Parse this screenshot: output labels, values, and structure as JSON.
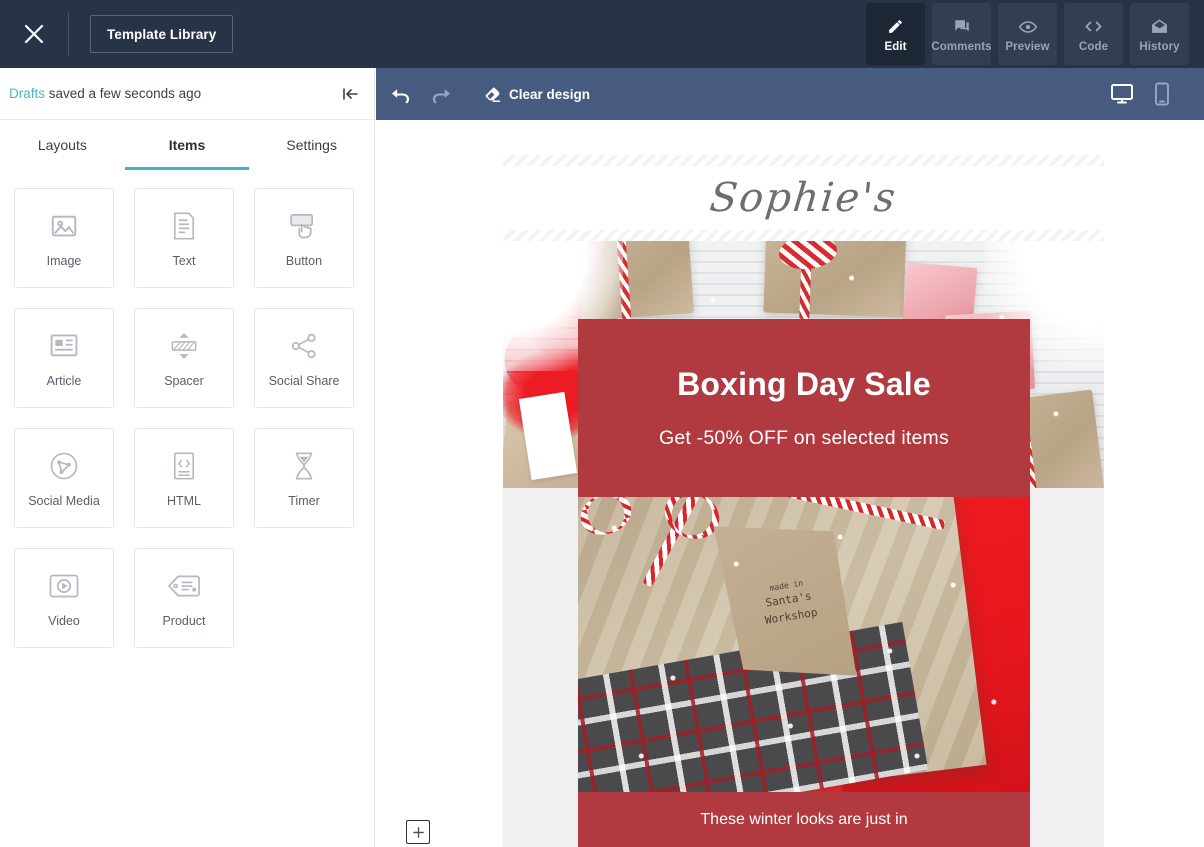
{
  "topbar": {
    "close_icon": "close-icon",
    "template_library_label": "Template Library",
    "modes": [
      {
        "label": "Edit",
        "icon": "pencil-icon",
        "active": true
      },
      {
        "label": "Comments",
        "icon": "comment-icon",
        "active": false
      },
      {
        "label": "Preview",
        "icon": "eye-icon",
        "active": false
      },
      {
        "label": "Code",
        "icon": "code-icon",
        "active": false
      },
      {
        "label": "History",
        "icon": "envelope-icon",
        "active": false
      }
    ]
  },
  "left_panel": {
    "draft_status_link": "Drafts",
    "draft_status_text": " saved a few seconds ago",
    "collapse_icon": "collapse-panel-icon",
    "tabs": [
      {
        "label": "Layouts",
        "active": false
      },
      {
        "label": "Items",
        "active": true
      },
      {
        "label": "Settings",
        "active": false
      }
    ],
    "items": [
      {
        "label": "Image",
        "icon": "image-icon"
      },
      {
        "label": "Text",
        "icon": "text-icon"
      },
      {
        "label": "Button",
        "icon": "button-icon"
      },
      {
        "label": "Article",
        "icon": "article-icon"
      },
      {
        "label": "Spacer",
        "icon": "spacer-icon"
      },
      {
        "label": "Social Share",
        "icon": "social-share-icon"
      },
      {
        "label": "Social Media",
        "icon": "social-media-icon"
      },
      {
        "label": "HTML",
        "icon": "html-icon"
      },
      {
        "label": "Timer",
        "icon": "timer-icon"
      },
      {
        "label": "Video",
        "icon": "video-icon"
      },
      {
        "label": "Product",
        "icon": "product-tag-icon"
      }
    ]
  },
  "editor_toolbar": {
    "undo_icon": "undo-icon",
    "redo_icon": "redo-icon",
    "clear_design_label": "Clear design",
    "clear_design_icon": "eraser-icon",
    "desktop_icon": "desktop-icon",
    "mobile_icon": "mobile-icon",
    "active_device": "desktop"
  },
  "canvas": {
    "add_block_label": "+",
    "email": {
      "brand_name": "Sophie's",
      "sale_title": "Boxing Day Sale",
      "sale_subtitle": "Get -50% OFF on selected items",
      "product_tag_line1": "made in",
      "product_tag_line2": "Santa's",
      "product_tag_line3": "Workshop",
      "footer_text": "These winter looks are just in"
    }
  },
  "colors": {
    "topbar_bg": "#283347",
    "editor_toolbar_bg": "#475a80",
    "accent_teal": "#38b8cc",
    "sale_red": "#b03a40",
    "canvas_bg": "#ffffff",
    "email_bg": "#f0f0f2"
  }
}
